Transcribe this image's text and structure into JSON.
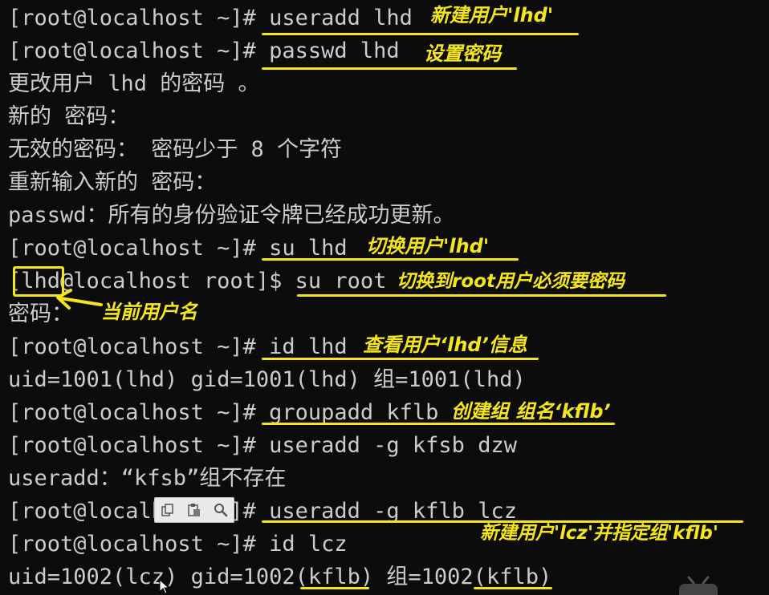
{
  "terminal": {
    "lines": [
      {
        "prompt": "[root@localhost ~]# ",
        "command": "useradd lhd"
      },
      {
        "prompt": "[root@localhost ~]# ",
        "command": "passwd lhd"
      },
      {
        "text": "更改用户 lhd 的密码 。"
      },
      {
        "text": "新的 密码："
      },
      {
        "text": "无效的密码： 密码少于 8 个字符"
      },
      {
        "text": "重新输入新的 密码："
      },
      {
        "text": "passwd：所有的身份验证令牌已经成功更新。"
      },
      {
        "prompt": "[root@localhost ~]# ",
        "command": "su lhd"
      },
      {
        "prompt_user": "lhd",
        "prompt_rest": "@localhost root]$ ",
        "command": "su root"
      },
      {
        "text": "密码："
      },
      {
        "prompt": "[root@localhost ~]# ",
        "command": "id lhd"
      },
      {
        "text": "uid=1001(lhd) gid=1001(lhd) 组=1001(lhd)"
      },
      {
        "prompt": "[root@localhost ~]# ",
        "command": "groupadd kflb"
      },
      {
        "prompt": "[root@localhost ~]# ",
        "command": "useradd -g kfsb dzw"
      },
      {
        "text": "useradd：“kfsb”组不存在"
      },
      {
        "prompt": "[root@localhost ~]# ",
        "command": "useradd -g kflb lcz"
      },
      {
        "prompt": "[root@localhost ~]# ",
        "command": "id lcz"
      },
      {
        "text": "uid=1002(lcz) gid=1002(kflb) 组=1002(kflb)"
      }
    ]
  },
  "annotations": {
    "a1": "新建用户'lhd'",
    "a2": "设置密码",
    "a3": "切换用户'lhd'",
    "a4": "切换到root用户必须要密码",
    "a5": "当前用户名",
    "a6": "查看用户‘lhd’信息",
    "a7": "创建组 组名‘kflb’",
    "a8": "新建用户'lcz'并指定组'kflb'"
  },
  "colors": {
    "background": "#0c0c0c",
    "text": "#cccccc",
    "annotation": "#f5e61b"
  },
  "toolbar_icons": [
    "copy-icon",
    "paste-icon",
    "search-icon"
  ]
}
